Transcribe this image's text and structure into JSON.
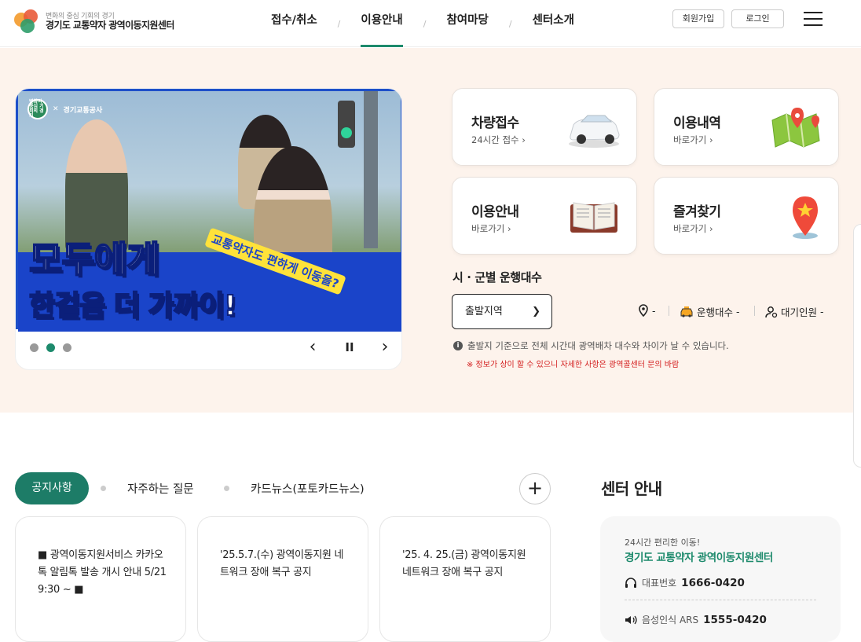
{
  "header": {
    "logo_sub": "변화의 중심 기회의 경기",
    "logo_main": "경기도 교통약자 광역이동지원센터",
    "nav": [
      "접수/취소",
      "이용안내",
      "참여마당",
      "센터소개"
    ],
    "nav_separator": "/",
    "active_nav": "이용안내",
    "signup": "회원가입",
    "login": "로그인"
  },
  "banner": {
    "logo_badge": "변화의 중심 기회의 경기",
    "partner": "경기교통공사",
    "headline1": "모두에게",
    "headline2": "한걸음 더 가까이!",
    "slogan": "교통약자도 편하게 이동을?",
    "controls": {
      "prev": "‹",
      "pause": "II",
      "next": "›"
    }
  },
  "quick": [
    {
      "title": "차량접수",
      "sub": "24시간 접수 ›"
    },
    {
      "title": "이용내역",
      "sub": "바로가기 ›"
    },
    {
      "title": "이용안내",
      "sub": "바로가기 ›"
    },
    {
      "title": "즐겨찾기",
      "sub": "바로가기 ›"
    }
  ],
  "stats": {
    "title": "시 · 군별 운행대수",
    "select_value": "출발지역",
    "location_value": "-",
    "vehicles_label": "운행대수",
    "vehicles_value": "-",
    "waiting_label": "대기인원",
    "waiting_value": "-",
    "info": "출발지 기준으로 전체 시간대 광역배차 대수와 차이가 날 수 있습니다.",
    "warning": "※ 정보가 상이 할 수 있으니 자세한 사항은 광역콜센터 문의 바람"
  },
  "board": {
    "tabs": [
      "공지사항",
      "자주하는 질문",
      "카드뉴스(포토카드뉴스)"
    ],
    "plus": "+",
    "notices": [
      "■ 광역이동지원서비스 카카오톡 알림톡 발송 개시 안내 5/21 9:30 ~ ■",
      "'25.5.7.(수) 광역이동지원 네트워크 장애 복구 공지",
      "'25. 4. 25.(금) 광역이동지원 네트워크 장애 복구 공지"
    ]
  },
  "center": {
    "title": "센터 안내",
    "sub": "24시간 편리한 이동!",
    "name": "경기도 교통약자 광역이동지원센터",
    "rep_label": "대표번호",
    "rep_number": "1666-0420",
    "ars_label": "음성인식 ARS",
    "ars_number": "1555-0420"
  },
  "colors": {
    "accent": "#1d8a6c",
    "hero_bg": "#fdf3ec",
    "banner_blue": "#1a44c9",
    "warning": "#d42020"
  }
}
